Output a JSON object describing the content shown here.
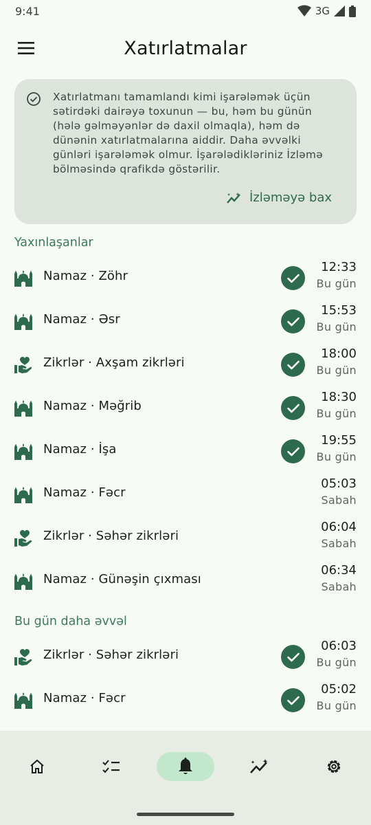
{
  "status_bar": {
    "time": "9:41",
    "network": "3G"
  },
  "app_bar": {
    "title": "Xatırlatmalar"
  },
  "info_card": {
    "lines": [
      "Xatırlatmanı tamamlandı kimi işarələmək üçün",
      "sətirdəki dairəyə toxunun — bu, həm bu günün",
      "(hələ gəlməyənlər də daxil olmaqla), həm də",
      "dünənin xatırlatmalarına aiddir. Daha əvvəlki",
      "günləri işarələmək olmur. İşarələdikləriniz İzləmə",
      "bölməsində qrafikdə göstərilir."
    ],
    "link_label": "İzləməyə bax"
  },
  "sections": {
    "upcoming_title": "Yaxınlaşanlar",
    "earlier_title": "Bu gün daha əvvəl"
  },
  "upcoming": [
    {
      "icon": "mosque-icon",
      "label": "Namaz · Zöhr",
      "time": "12:33",
      "day": "Bu gün",
      "done": true
    },
    {
      "icon": "mosque-icon",
      "label": "Namaz · Əsr",
      "time": "15:53",
      "day": "Bu gün",
      "done": true
    },
    {
      "icon": "hand-heart-icon",
      "label": "Zikrlər · Axşam zikrləri",
      "time": "18:00",
      "day": "Bu gün",
      "done": true
    },
    {
      "icon": "mosque-icon",
      "label": "Namaz · Məğrib",
      "time": "18:30",
      "day": "Bu gün",
      "done": true
    },
    {
      "icon": "mosque-icon",
      "label": "Namaz · İşa",
      "time": "19:55",
      "day": "Bu gün",
      "done": true
    },
    {
      "icon": "mosque-icon",
      "label": "Namaz · Fəcr",
      "time": "05:03",
      "day": "Sabah",
      "done": false
    },
    {
      "icon": "hand-heart-icon",
      "label": "Zikrlər · Səhər zikrləri",
      "time": "06:04",
      "day": "Sabah",
      "done": false
    },
    {
      "icon": "mosque-icon",
      "label": "Namaz · Günəşin çıxması",
      "time": "06:34",
      "day": "Sabah",
      "done": false
    }
  ],
  "earlier": [
    {
      "icon": "hand-heart-icon",
      "label": "Zikrlər · Səhər zikrləri",
      "time": "06:03",
      "day": "Bu gün",
      "done": true
    },
    {
      "icon": "mosque-icon",
      "label": "Namaz · Fəcr",
      "time": "05:02",
      "day": "Bu gün",
      "done": true
    }
  ],
  "bottom_nav": [
    {
      "icon": "home-icon",
      "active": false
    },
    {
      "icon": "checklist-icon",
      "active": false
    },
    {
      "icon": "bell-icon",
      "active": true
    },
    {
      "icon": "trending-icon",
      "active": false
    },
    {
      "icon": "settings-icon",
      "active": false
    }
  ],
  "colors": {
    "background": "#f6fbf5",
    "accent": "#2e6a4e",
    "card": "#dde4dc",
    "active_nav": "#c3e7cc"
  }
}
